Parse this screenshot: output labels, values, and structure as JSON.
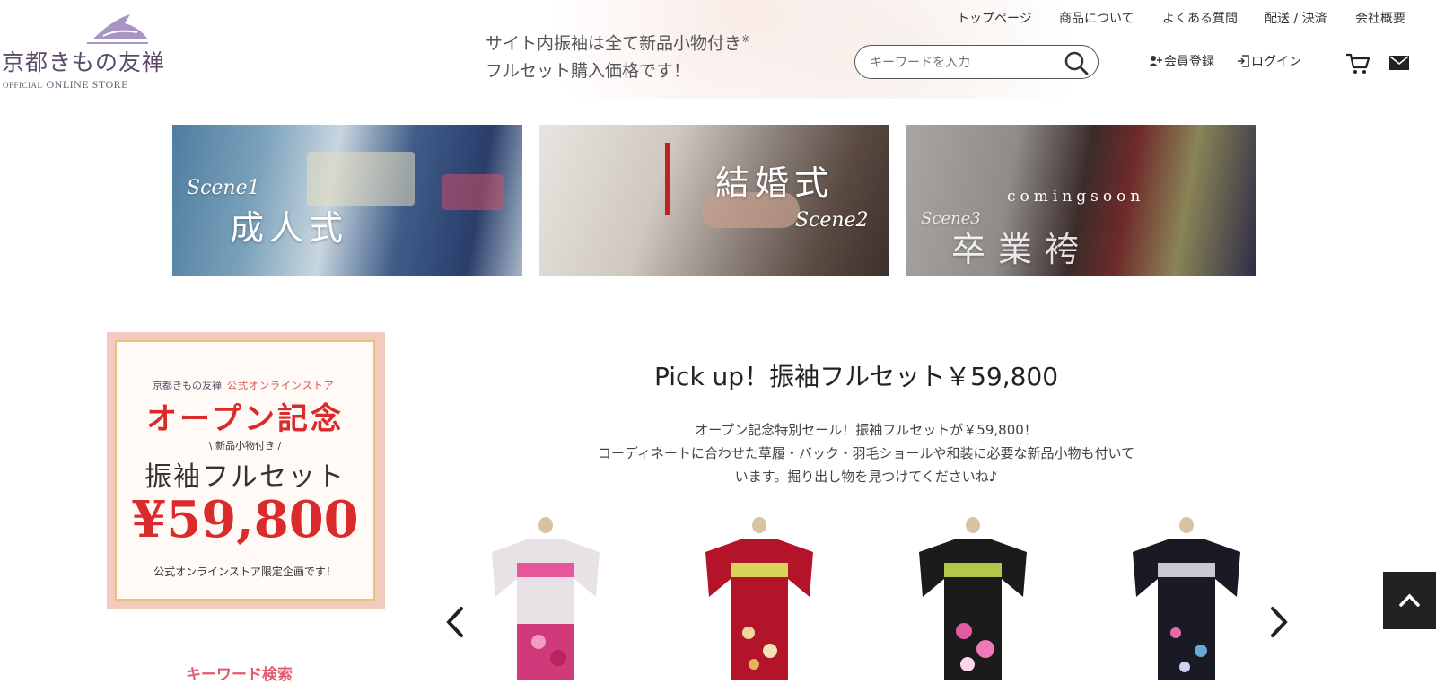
{
  "logo": {
    "name": "京都きもの友禅",
    "sub_small": "OFFICIAL",
    "sub": "ONLINE STORE"
  },
  "header": {
    "notice_line1": "サイト内振袖は全て新品小物付き",
    "notice_mark": "※",
    "notice_line2": "フルセット購入価格です！",
    "search_placeholder": "キーワードを入力",
    "nav": [
      "トップページ",
      "商品について",
      "よくある質問",
      "配送 / 決済",
      "会社概要"
    ],
    "register": "会員登録",
    "login": "ログイン",
    "cart_icon": "cart-icon",
    "mail_icon": "mail-icon"
  },
  "banners": [
    {
      "title": "成人式",
      "script": "Scene1"
    },
    {
      "title": "結婚式",
      "script": "Scene2"
    },
    {
      "title": "卒業袴",
      "script": "Scene3",
      "badge": "comingsoon"
    }
  ],
  "promo": {
    "brand": "京都きもの友禅",
    "brand_tag": "公式オンラインストア",
    "headline": "オープン記念",
    "small": "新品小物付き",
    "product": "振袖フルセット",
    "price": "¥59,800",
    "footer": "公式オンラインストア限定企画です！"
  },
  "pickup": {
    "title": "Pick up！振袖フルセット￥59,800",
    "desc1": "オープン記念特別セール！振袖フルセットが￥59,800！",
    "desc2": "コーディネートに合わせた草履・バック・羽毛ショールや和装に必要な新品小物も付いて",
    "desc3": "います。掘り出し物を見つけてくださいね♪"
  },
  "keyword_search": "キーワード検索",
  "colors": {
    "accent": "#d9534f",
    "brand": "#5b4a66",
    "link": "#e15a6d"
  }
}
